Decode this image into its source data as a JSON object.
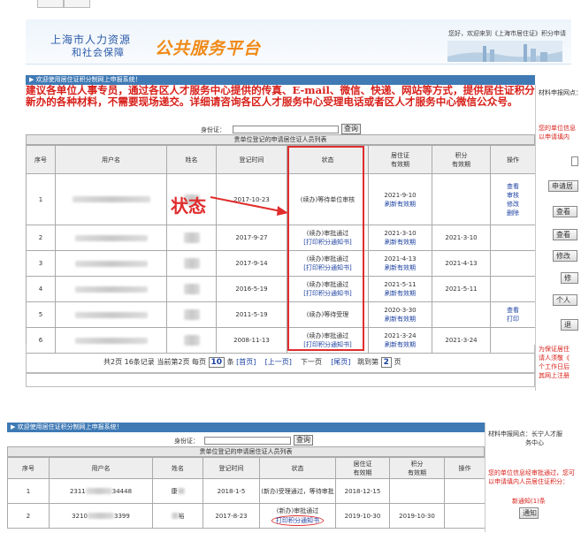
{
  "header": {
    "logo_line1": "上海市人力资源",
    "logo_line2": "和社会保障",
    "logo_big": "公共服务平台",
    "welcome": "您好，欢迎来到《上海市居住证》积分申请"
  },
  "panel1": {
    "bar_title": "▶ 欢迎使用居住证积分制网上申报系统！",
    "notice": "建议各单位人事专员，通过各区人才服务中心提供的传真、E-mail、微信、快递、网站等方式，提供居住证积分新办的各种材料，不需要现场递交。详细请咨询各区人才服务中心受理电话或者区人才服务中心微信公众号。",
    "id_label": "身份证：",
    "query_btn": "查询",
    "caption": "贵单位登记的申请居住证人员列表",
    "headers": [
      "序号",
      "用户名",
      "姓名",
      "登记时间",
      "状态",
      "居住证\n有效期",
      "积分\n有效期",
      "操作"
    ],
    "rows": [
      {
        "no": "1",
        "date": "2017-10-23",
        "status": "(续办)等待单位审核",
        "status2": "",
        "permit": "2021-9-10",
        "refresh": "刷新有效期",
        "score": "",
        "ops": [
          "查看",
          "审核",
          "修改",
          "删除"
        ]
      },
      {
        "no": "2",
        "date": "2017-9-27",
        "status": "(续办)审批通过",
        "status2": "[打印积分通知书]",
        "permit": "2021-3-10",
        "refresh": "刷新有效期",
        "score": "2021-3-10",
        "ops": []
      },
      {
        "no": "3",
        "date": "2017-9-14",
        "status": "(续办)审批通过",
        "status2": "[打印积分通知书]",
        "permit": "2021-4-13",
        "refresh": "刷新有效期",
        "score": "2021-4-13",
        "ops": []
      },
      {
        "no": "4",
        "date": "2016-5-19",
        "status": "(续办)审批通过",
        "status2": "[打印积分通知书]",
        "permit": "2021-5-11",
        "refresh": "刷新有效期",
        "score": "2021-5-11",
        "ops": []
      },
      {
        "no": "5",
        "date": "2011-5-19",
        "status": "(续办)等待受理",
        "status2": "",
        "permit": "2020-3-30",
        "refresh": "刷新有效期",
        "score": "",
        "ops": [
          "查看",
          "打印"
        ]
      },
      {
        "no": "6",
        "date": "2008-11-13",
        "status": "(续办)审批通过",
        "status2": "[打印积分通知书]",
        "permit": "2021-3-24",
        "refresh": "刷新有效期",
        "score": "2021-3-24",
        "ops": []
      }
    ],
    "annotation": "状态",
    "pager": {
      "summary": "共2页 16条记录 当前第2页 每页",
      "per_page": "10",
      "unit": "条",
      "first": "[首页]",
      "prev": "[上一页]",
      "next": "下一页",
      "last": "[尾页]",
      "jump": "跳到第",
      "page": "2",
      "page_unit": "页"
    }
  },
  "sidebar1": {
    "line1": "材料申报网点：",
    "line2": "您的单位信息",
    "line3": "以申请填内",
    "btn_apply": "申请居",
    "btn_view": "查看",
    "btn_view2": "查看",
    "btn_modify": "修改",
    "btn_modify2": "修",
    "btn_person": "个人",
    "btn_back": "退",
    "foot1": "为保证居住",
    "foot2": "请人须敬《",
    "foot3": "个工作日后",
    "foot4": "其网上注册"
  },
  "panel2": {
    "bar_title": "▶ 欢迎使用居住证积分制网上申报系统！",
    "id_label": "身份证：",
    "query_btn": "查询",
    "caption": "贵单位登记的申请居住证人员列表",
    "headers": [
      "序号",
      "用户名",
      "姓名",
      "登记时间",
      "状态",
      "居住证\n有效期",
      "积分\n有效期",
      "操作"
    ],
    "rows": [
      {
        "no": "1",
        "user_a": "2311",
        "user_b": "34448",
        "name": "康",
        "date": "2018-1-5",
        "status": "(新办)受理通过，等待审批",
        "status2": "",
        "permit": "2018-12-15",
        "score": ""
      },
      {
        "no": "2",
        "user_a": "3210",
        "user_b": "3399",
        "name": "裕",
        "date": "2017-8-23",
        "status": "(新办)审批通过",
        "status2": "打印积分通知书",
        "permit": "2019-10-30",
        "score": "2019-10-30"
      }
    ]
  },
  "sidebar2": {
    "site1": "材料申报网点：长宁人才服",
    "site2": "务中心",
    "info1": "您的单位信息经审批通过，您可",
    "info2": "以申请填内人员居住证积分：",
    "notice": "新通知(1)条",
    "notice_btn": "通知"
  }
}
